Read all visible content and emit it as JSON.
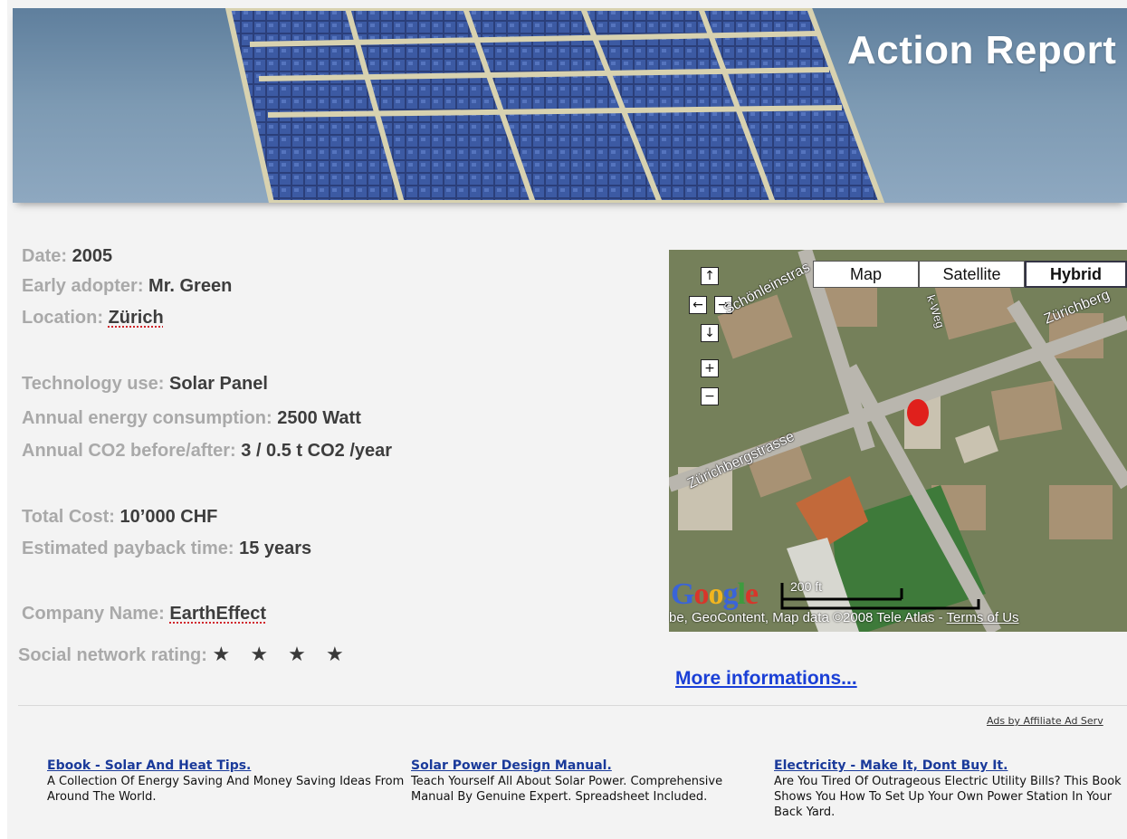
{
  "banner": {
    "title": "Action Report"
  },
  "info": {
    "date": {
      "label": "Date:",
      "value": "2005"
    },
    "adopter": {
      "label": "Early adopter:",
      "value": "Mr. Green"
    },
    "location": {
      "label": "Location:",
      "value": "Zürich"
    },
    "technology": {
      "label": "Technology use:",
      "value": "Solar Panel"
    },
    "energy": {
      "label": "Annual energy consumption:",
      "value": "2500 Watt"
    },
    "co2": {
      "label": "Annual CO2 before/after:",
      "value": "3 / 0.5 t CO2 /year"
    },
    "cost": {
      "label": "Total Cost:",
      "value": "10’000 CHF"
    },
    "payback": {
      "label": "Estimated payback time:",
      "value": "15 years"
    },
    "company": {
      "label": "Company Name:",
      "value": "EarthEffect"
    },
    "rating": {
      "label": "Social network rating:",
      "stars": "★ ★ ★ ★",
      "value": 4
    }
  },
  "map": {
    "types": [
      "Map",
      "Satellite",
      "Hybrid"
    ],
    "active_type": "Hybrid",
    "controls": {
      "up": "↑",
      "left": "←",
      "right": "→",
      "down": "↓",
      "zoom_in": "+",
      "zoom_out": "−"
    },
    "streets": [
      "Schönleinstras",
      "Zürichberg",
      "Zürichbergstrasse",
      "k-Weg"
    ],
    "scale_label": "200 ft",
    "logo": "Google",
    "attribution": "be, GeoContent, Map data ©2008 Tele Atlas - ",
    "terms": "Terms of Us"
  },
  "more_link": "More informations...",
  "ads": {
    "by": "Ads by Affiliate Ad Serv",
    "items": [
      {
        "title": "Ebook - Solar And Heat Tips.",
        "desc": "A Collection Of Energy Saving And Money Saving Ideas From Around The World."
      },
      {
        "title": "Solar Power Design Manual.",
        "desc": "Teach Yourself All About Solar Power. Comprehensive Manual By Genuine Expert. Spreadsheet Included."
      },
      {
        "title": "Electricity - Make It, Dont Buy It.",
        "desc": "Are You Tired Of Outrageous Electric Utility Bills? This Book Shows You How To Set Up Your Own Power Station In Your Back Yard."
      }
    ]
  },
  "colors": {
    "link": "#1a3fd6",
    "label_grey": "#a8a8a8",
    "value_dark": "#3d3d3d",
    "sky": "#7d9ab3"
  }
}
